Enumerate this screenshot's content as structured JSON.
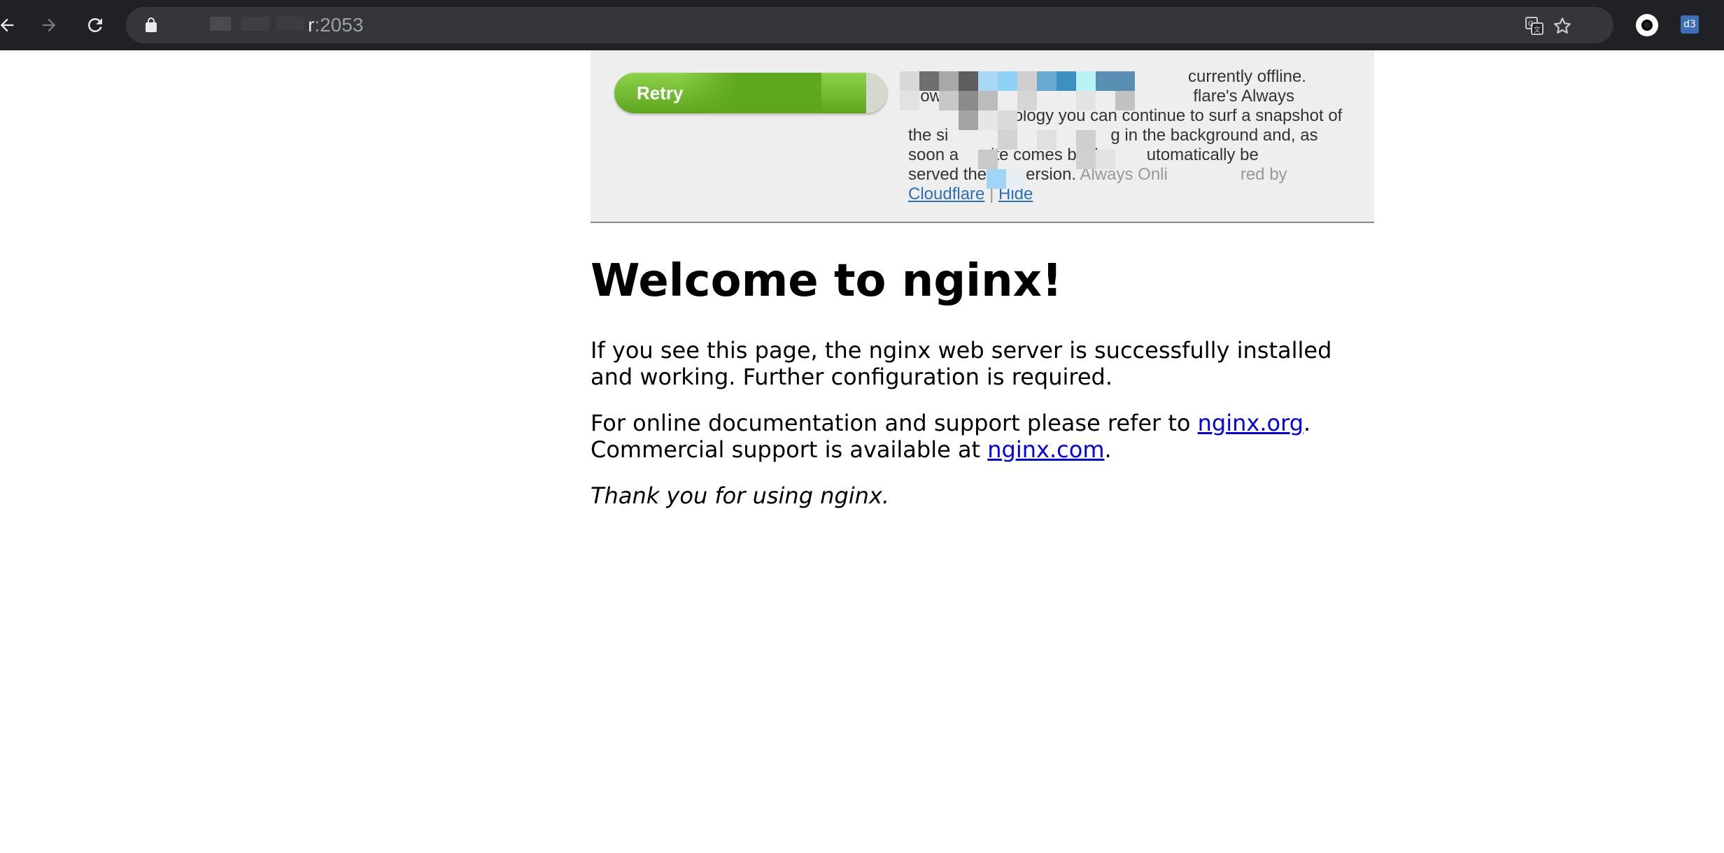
{
  "browser": {
    "url_host": "r",
    "url_port": ":2053",
    "icons": {
      "back": "arrow-left-icon",
      "forward": "arrow-right-icon",
      "reload": "reload-icon",
      "lock": "lock-icon",
      "translate": "translate-icon",
      "bookmark": "star-icon",
      "extension_1": "circle-extension-icon",
      "extension_2": "d3-extension-icon"
    },
    "extension_2_label": "d3"
  },
  "cloudflare_banner": {
    "retry_button_label": "Retry",
    "lines": [
      "currently offline.",
      "flare's Always",
      "hnology you can continue to surf a snapshot of",
      "g in the background and, as",
      "site comes back,",
      "utomatically be",
      "version.",
      "Always Onli",
      "red by"
    ],
    "line_prefixes": [
      "Howe",
      "the si",
      "soon a",
      "served the"
    ],
    "cloudflare_link": "Cloudflare",
    "separator": "|",
    "hide_link": "Hide",
    "colors": {
      "button_top": "#8ed14a",
      "button_bottom": "#5ea61e",
      "link": "#2b70b9",
      "muted_text": "#999999"
    }
  },
  "nginx": {
    "title": "Welcome to nginx!",
    "para1": "If you see this page, the nginx web server is successfully installed and working. Further configuration is required.",
    "para2_prefix": "For online documentation and support please refer to",
    "org_link": "nginx.org",
    "para2_mid": "Commercial support is available at",
    "com_link": "nginx.com",
    "thanks": "Thank you for using nginx."
  }
}
